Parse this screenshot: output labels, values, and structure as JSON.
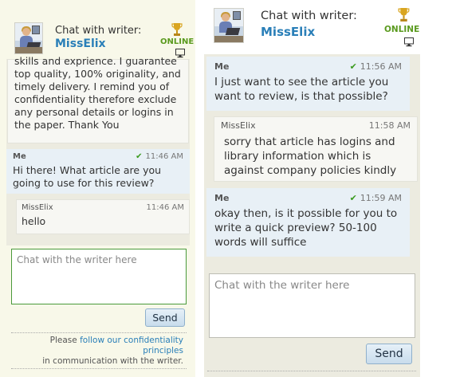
{
  "left": {
    "header": {
      "chat_label": "Chat with writer:",
      "writer_name": "MissElix",
      "status": "ONLINE"
    },
    "partial_message": {
      "lines": [
        "skills and exprience. I guarantee",
        "top quality, 100% originality, and",
        "timely delivery. I remind you of",
        "confidentiality therefore exclude",
        "any personal details or logins in",
        "the paper. Thank You"
      ]
    },
    "messages": [
      {
        "sender": "Me",
        "time": "11:46 AM",
        "text": "Hi there! What article are you going to use for this review?"
      },
      {
        "sender": "MissElix",
        "time": "11:46 AM",
        "text": "hello"
      }
    ],
    "input_placeholder": "Chat with the writer here",
    "send_label": "Send",
    "footer": {
      "prefix": "Please ",
      "link": "follow our confidentiality principles",
      "suffix": "in communication with the writer."
    }
  },
  "right": {
    "header": {
      "chat_label": "Chat with writer:",
      "writer_name": "MissElix",
      "status": "ONLINE"
    },
    "messages": [
      {
        "sender": "Me",
        "time": "11:56 AM",
        "text": "I just want to see the article you want to review, is that possible?"
      },
      {
        "sender": "MissElix",
        "time": "11:58 AM",
        "text": "sorry that article has logins and library information which is against company policies kindly"
      },
      {
        "sender": "Me",
        "time": "11:59 AM",
        "text": "okay then, is it possible for you to write a quick preview? 50-100 words will suffice"
      }
    ],
    "input_placeholder": "Chat with the writer here",
    "send_label": "Send"
  },
  "colors": {
    "link": "#2a7fb8",
    "online": "#5a9a1e",
    "checkmark": "#3a9a1e",
    "panel_bg": "#ecebe0"
  }
}
